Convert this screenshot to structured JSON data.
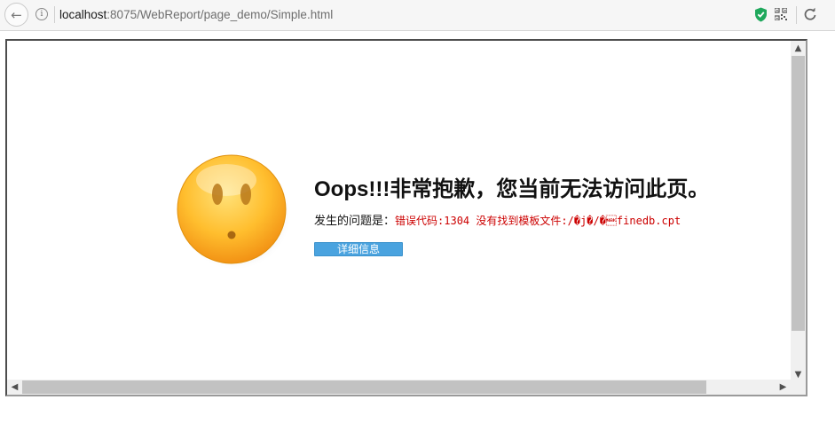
{
  "browser": {
    "url_host": "localhost",
    "url_rest": ":8075/WebReport/page_demo/Simple.html",
    "icons": [
      "back-arrow-icon",
      "info-icon",
      "shield-icon",
      "qr-code-icon",
      "reload-icon"
    ]
  },
  "error_page": {
    "title": "Oops!!!非常抱歉，您当前无法访问此页。",
    "problem_label": "发生的问题是：",
    "problem_message": "错误代码:1304 没有找到模板文件:/�j�/�\u0015finedb.cpt",
    "details_button": "详细信息",
    "button_color": "#4aa3df",
    "message_color": "#cc0000"
  }
}
